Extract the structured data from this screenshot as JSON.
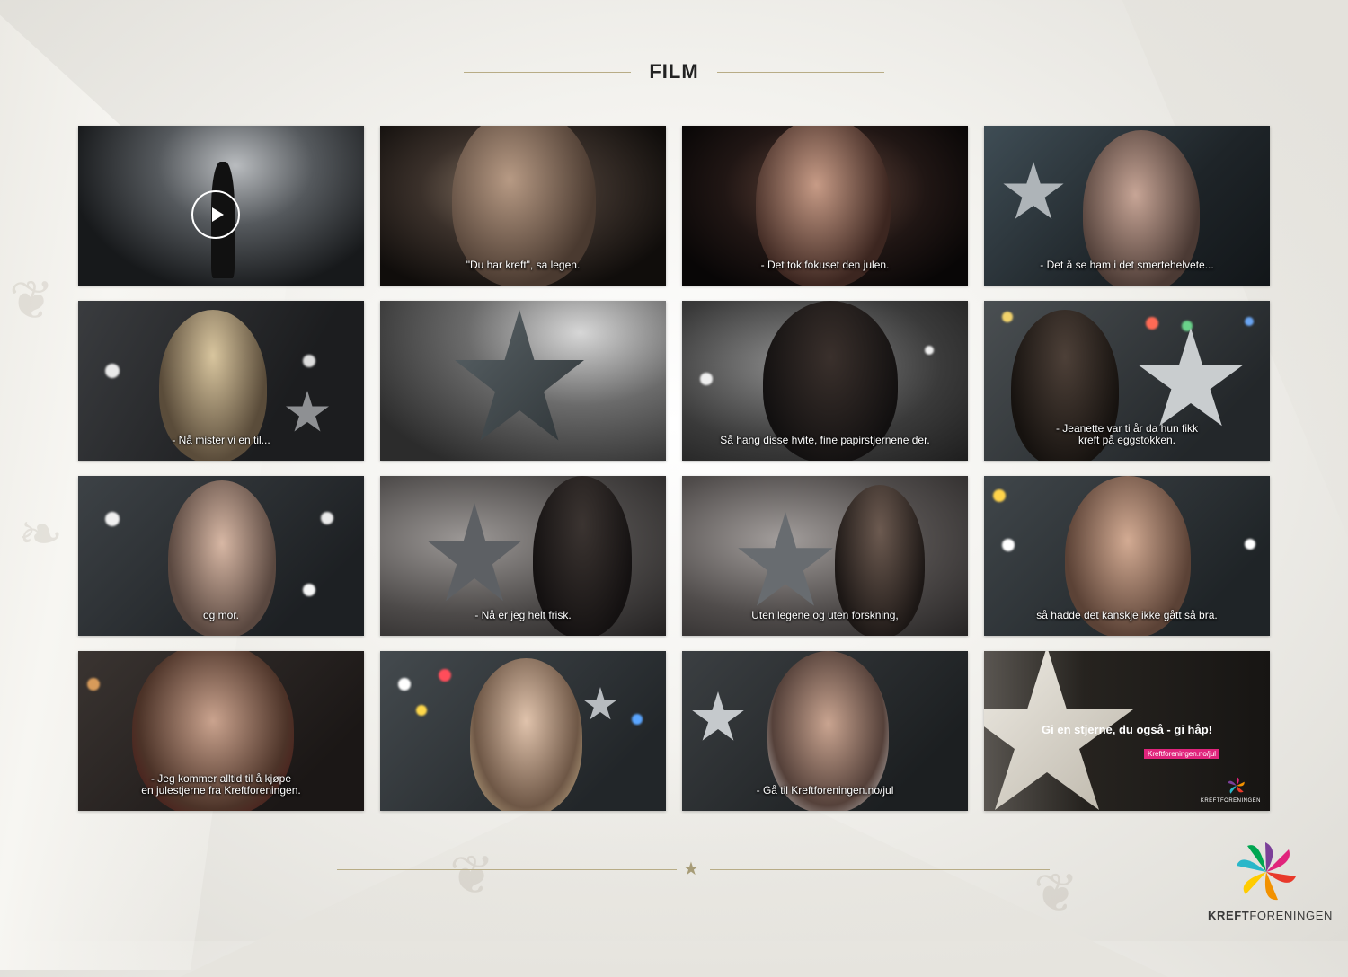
{
  "page": {
    "title": "FILM"
  },
  "tiles": [
    {
      "caption": "",
      "has_play": true,
      "scene": "stage"
    },
    {
      "caption": "\"Du har kreft\", sa legen.",
      "scene": "face-man-dark"
    },
    {
      "caption": "- Det tok fokuset den julen.",
      "scene": "face-woman-dark"
    },
    {
      "caption": "- Det å se ham i det smertehelvete...",
      "scene": "face-oldman"
    },
    {
      "caption": "- Nå mister vi en til...",
      "scene": "woman-profile"
    },
    {
      "caption": "",
      "scene": "star"
    },
    {
      "caption": "Så hang disse hvite, fine papirstjernene der.",
      "scene": "boy-profile"
    },
    {
      "caption": "- Jeanette var ti år da hun fikk\nkreft på eggstokken.",
      "scene": "boy-back"
    },
    {
      "caption": "og mor.",
      "scene": "face-woman-short"
    },
    {
      "caption": "- Nå er jeg helt frisk.",
      "scene": "man-star"
    },
    {
      "caption": "Uten legene og uten forskning,",
      "scene": "man-star-2"
    },
    {
      "caption": "så hadde det kanskje ikke gått så bra.",
      "scene": "face-boy"
    },
    {
      "caption": "- Jeg kommer alltid til å kjøpe\nen julestjerne fra Kreftforeningen.",
      "scene": "face-woman-red"
    },
    {
      "caption": "",
      "scene": "face-woman-blonde"
    },
    {
      "caption": "- Gå til Kreftforeningen.no/jul",
      "scene": "face-oldman-2"
    },
    {
      "caption": "",
      "scene": "endcard",
      "end_title": "Gi en stjerne, du også - gi håp!",
      "end_url": "Kreftforeningen.no/jul",
      "end_logo": "KREFTFORENINGEN"
    }
  ],
  "brand": {
    "logo_bold": "KREFT",
    "logo_regular": "FORENINGEN",
    "colors": {
      "gold": "#b8ac86",
      "pink": "#e0247c",
      "teal": "#2ab7c9",
      "orange": "#f29100",
      "purple": "#7b3f98"
    }
  }
}
